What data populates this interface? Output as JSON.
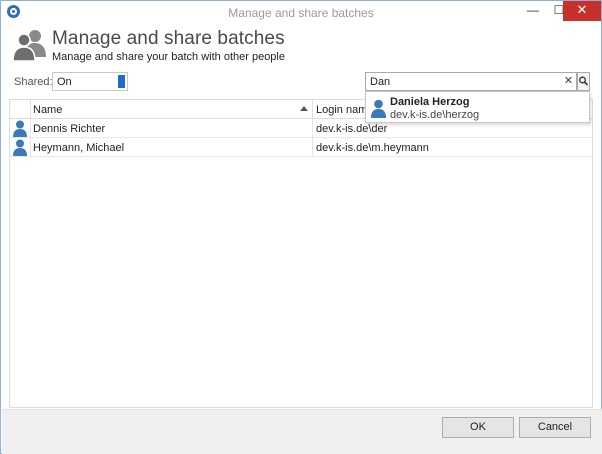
{
  "window": {
    "title": "Manage and share batches",
    "minimize_glyph": "—",
    "maximize_glyph": "☐",
    "close_glyph": "✕"
  },
  "header": {
    "title": "Manage and share batches",
    "subtitle": "Manage and share your batch with other people",
    "icon": "users-icon"
  },
  "shared": {
    "label": "Shared:",
    "value": "On"
  },
  "search": {
    "value": "Dan",
    "clear_glyph": "✕",
    "icon": "search-icon"
  },
  "grid": {
    "columns": [
      "Name",
      "Login name"
    ],
    "sorted_column": "Name",
    "rows": [
      {
        "name": "Dennis Richter",
        "login": "dev.k-is.de\\der",
        "icon": "user-icon"
      },
      {
        "name": "Heymann, Michael",
        "login": "dev.k-is.de\\m.heymann",
        "icon": "user-icon"
      }
    ]
  },
  "suggestion": {
    "name": "Daniela Herzog",
    "login": "dev.k-is.de\\herzog",
    "icon": "user-icon"
  },
  "footer": {
    "ok_label": "OK",
    "cancel_label": "Cancel"
  },
  "colors": {
    "accent": "#1e6ec8",
    "user_icon": "#3d78b8",
    "close_button": "#c7302b",
    "title_text": "#9a9a9a"
  }
}
